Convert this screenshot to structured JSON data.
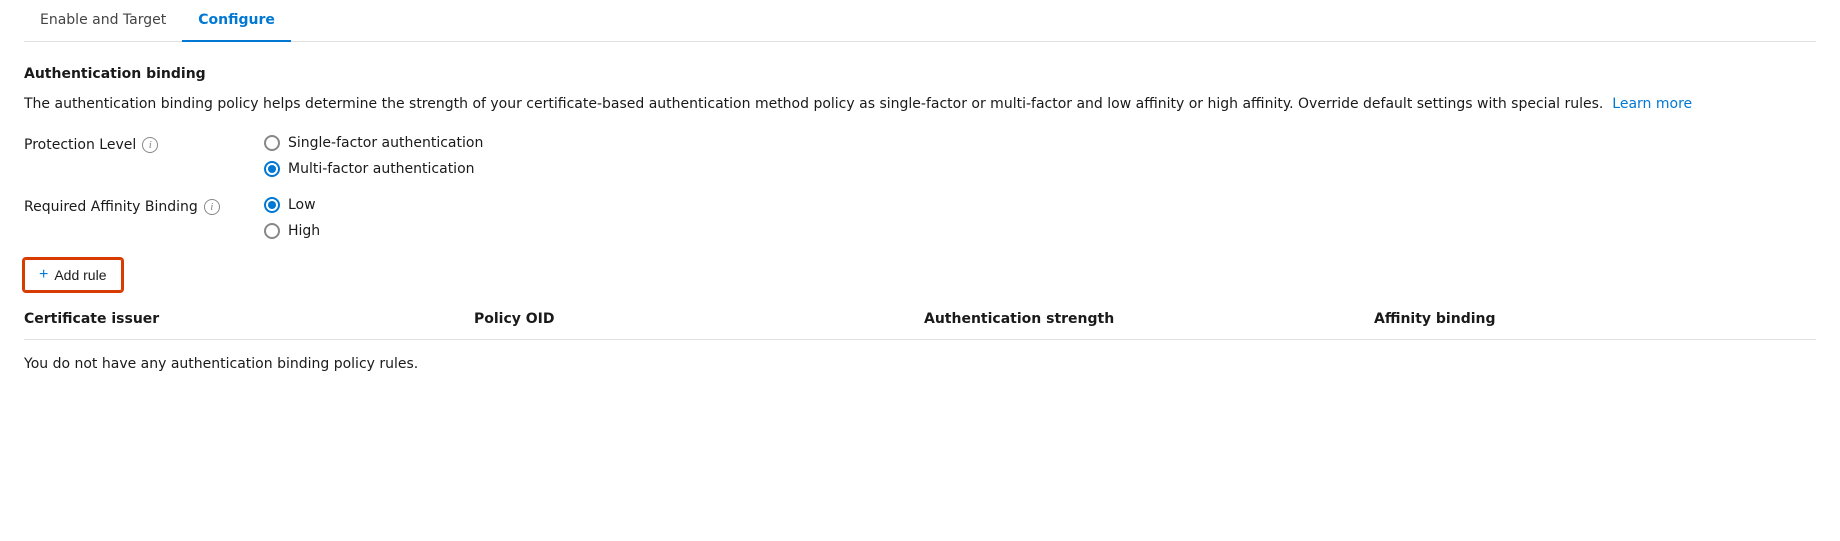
{
  "tabs": [
    {
      "id": "enable-target",
      "label": "Enable and Target",
      "active": false
    },
    {
      "id": "configure",
      "label": "Configure",
      "active": true
    }
  ],
  "section": {
    "title": "Authentication binding",
    "description": "The authentication binding policy helps determine the strength of your certificate-based authentication method policy as single-factor or multi-factor and low affinity or high affinity. Override default settings with special rules.",
    "learn_more_label": "Learn more"
  },
  "protection_level": {
    "label": "Protection Level",
    "options": [
      {
        "id": "single-factor",
        "label": "Single-factor authentication",
        "checked": false
      },
      {
        "id": "multi-factor",
        "label": "Multi-factor authentication",
        "checked": true
      }
    ]
  },
  "affinity_binding": {
    "label": "Required Affinity Binding",
    "options": [
      {
        "id": "low",
        "label": "Low",
        "checked": true
      },
      {
        "id": "high",
        "label": "High",
        "checked": false
      }
    ]
  },
  "add_rule_button": "+ Add rule",
  "table": {
    "columns": [
      "Certificate issuer",
      "Policy OID",
      "Authentication strength",
      "Affinity binding"
    ],
    "empty_message": "You do not have any authentication binding policy rules."
  }
}
